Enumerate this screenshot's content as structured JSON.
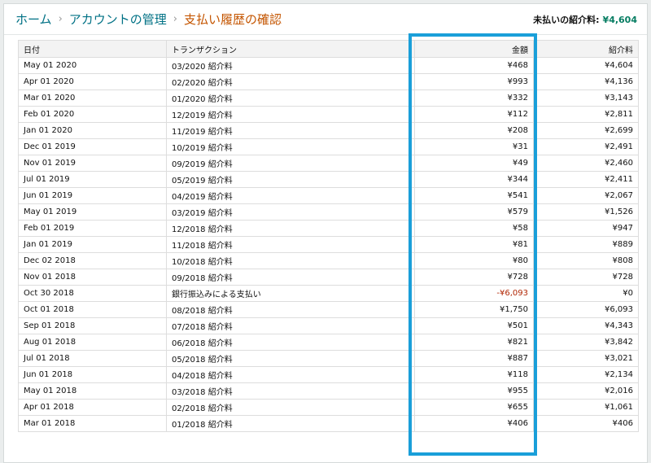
{
  "breadcrumb": {
    "items": [
      "ホーム",
      "アカウントの管理"
    ],
    "current": "支払い履歴の確認",
    "separator": "›"
  },
  "unpaid": {
    "label": "未払いの紹介料:",
    "value": "¥4,604",
    "color": "#067d62"
  },
  "table": {
    "headers": {
      "date": "日付",
      "transaction": "トランザクション",
      "amount": "金額",
      "referral": "紹介料"
    },
    "rows": [
      {
        "date": "May 01 2020",
        "transaction": "03/2020 紹介料",
        "amount": "¥468",
        "referral": "¥4,604"
      },
      {
        "date": "Apr 01 2020",
        "transaction": "02/2020 紹介料",
        "amount": "¥993",
        "referral": "¥4,136"
      },
      {
        "date": "Mar 01 2020",
        "transaction": "01/2020 紹介料",
        "amount": "¥332",
        "referral": "¥3,143"
      },
      {
        "date": "Feb 01 2020",
        "transaction": "12/2019 紹介料",
        "amount": "¥112",
        "referral": "¥2,811"
      },
      {
        "date": "Jan 01 2020",
        "transaction": "11/2019 紹介料",
        "amount": "¥208",
        "referral": "¥2,699"
      },
      {
        "date": "Dec 01 2019",
        "transaction": "10/2019 紹介料",
        "amount": "¥31",
        "referral": "¥2,491"
      },
      {
        "date": "Nov 01 2019",
        "transaction": "09/2019 紹介料",
        "amount": "¥49",
        "referral": "¥2,460"
      },
      {
        "date": "Jul 01 2019",
        "transaction": "05/2019 紹介料",
        "amount": "¥344",
        "referral": "¥2,411"
      },
      {
        "date": "Jun 01 2019",
        "transaction": "04/2019 紹介料",
        "amount": "¥541",
        "referral": "¥2,067"
      },
      {
        "date": "May 01 2019",
        "transaction": "03/2019 紹介料",
        "amount": "¥579",
        "referral": "¥1,526"
      },
      {
        "date": "Feb 01 2019",
        "transaction": "12/2018 紹介料",
        "amount": "¥58",
        "referral": "¥947"
      },
      {
        "date": "Jan 01 2019",
        "transaction": "11/2018 紹介料",
        "amount": "¥81",
        "referral": "¥889"
      },
      {
        "date": "Dec 02 2018",
        "transaction": "10/2018 紹介料",
        "amount": "¥80",
        "referral": "¥808"
      },
      {
        "date": "Nov 01 2018",
        "transaction": "09/2018 紹介料",
        "amount": "¥728",
        "referral": "¥728"
      },
      {
        "date": "Oct 30 2018",
        "transaction": "銀行振込みによる支払い",
        "amount": "-¥6,093",
        "referral": "¥0",
        "negative": true
      },
      {
        "date": "Oct 01 2018",
        "transaction": "08/2018 紹介料",
        "amount": "¥1,750",
        "referral": "¥6,093"
      },
      {
        "date": "Sep 01 2018",
        "transaction": "07/2018 紹介料",
        "amount": "¥501",
        "referral": "¥4,343"
      },
      {
        "date": "Aug 01 2018",
        "transaction": "06/2018 紹介料",
        "amount": "¥821",
        "referral": "¥3,842"
      },
      {
        "date": "Jul 01 2018",
        "transaction": "05/2018 紹介料",
        "amount": "¥887",
        "referral": "¥3,021"
      },
      {
        "date": "Jun 01 2018",
        "transaction": "04/2018 紹介料",
        "amount": "¥118",
        "referral": "¥2,134"
      },
      {
        "date": "May 01 2018",
        "transaction": "03/2018 紹介料",
        "amount": "¥955",
        "referral": "¥2,016"
      },
      {
        "date": "Apr 01 2018",
        "transaction": "02/2018 紹介料",
        "amount": "¥655",
        "referral": "¥1,061"
      },
      {
        "date": "Mar 01 2018",
        "transaction": "01/2018 紹介料",
        "amount": "¥406",
        "referral": "¥406"
      }
    ]
  },
  "colors": {
    "link": "#007185",
    "current": "#c45500",
    "negative": "#b12704",
    "highlight": "#1a9fd9"
  }
}
